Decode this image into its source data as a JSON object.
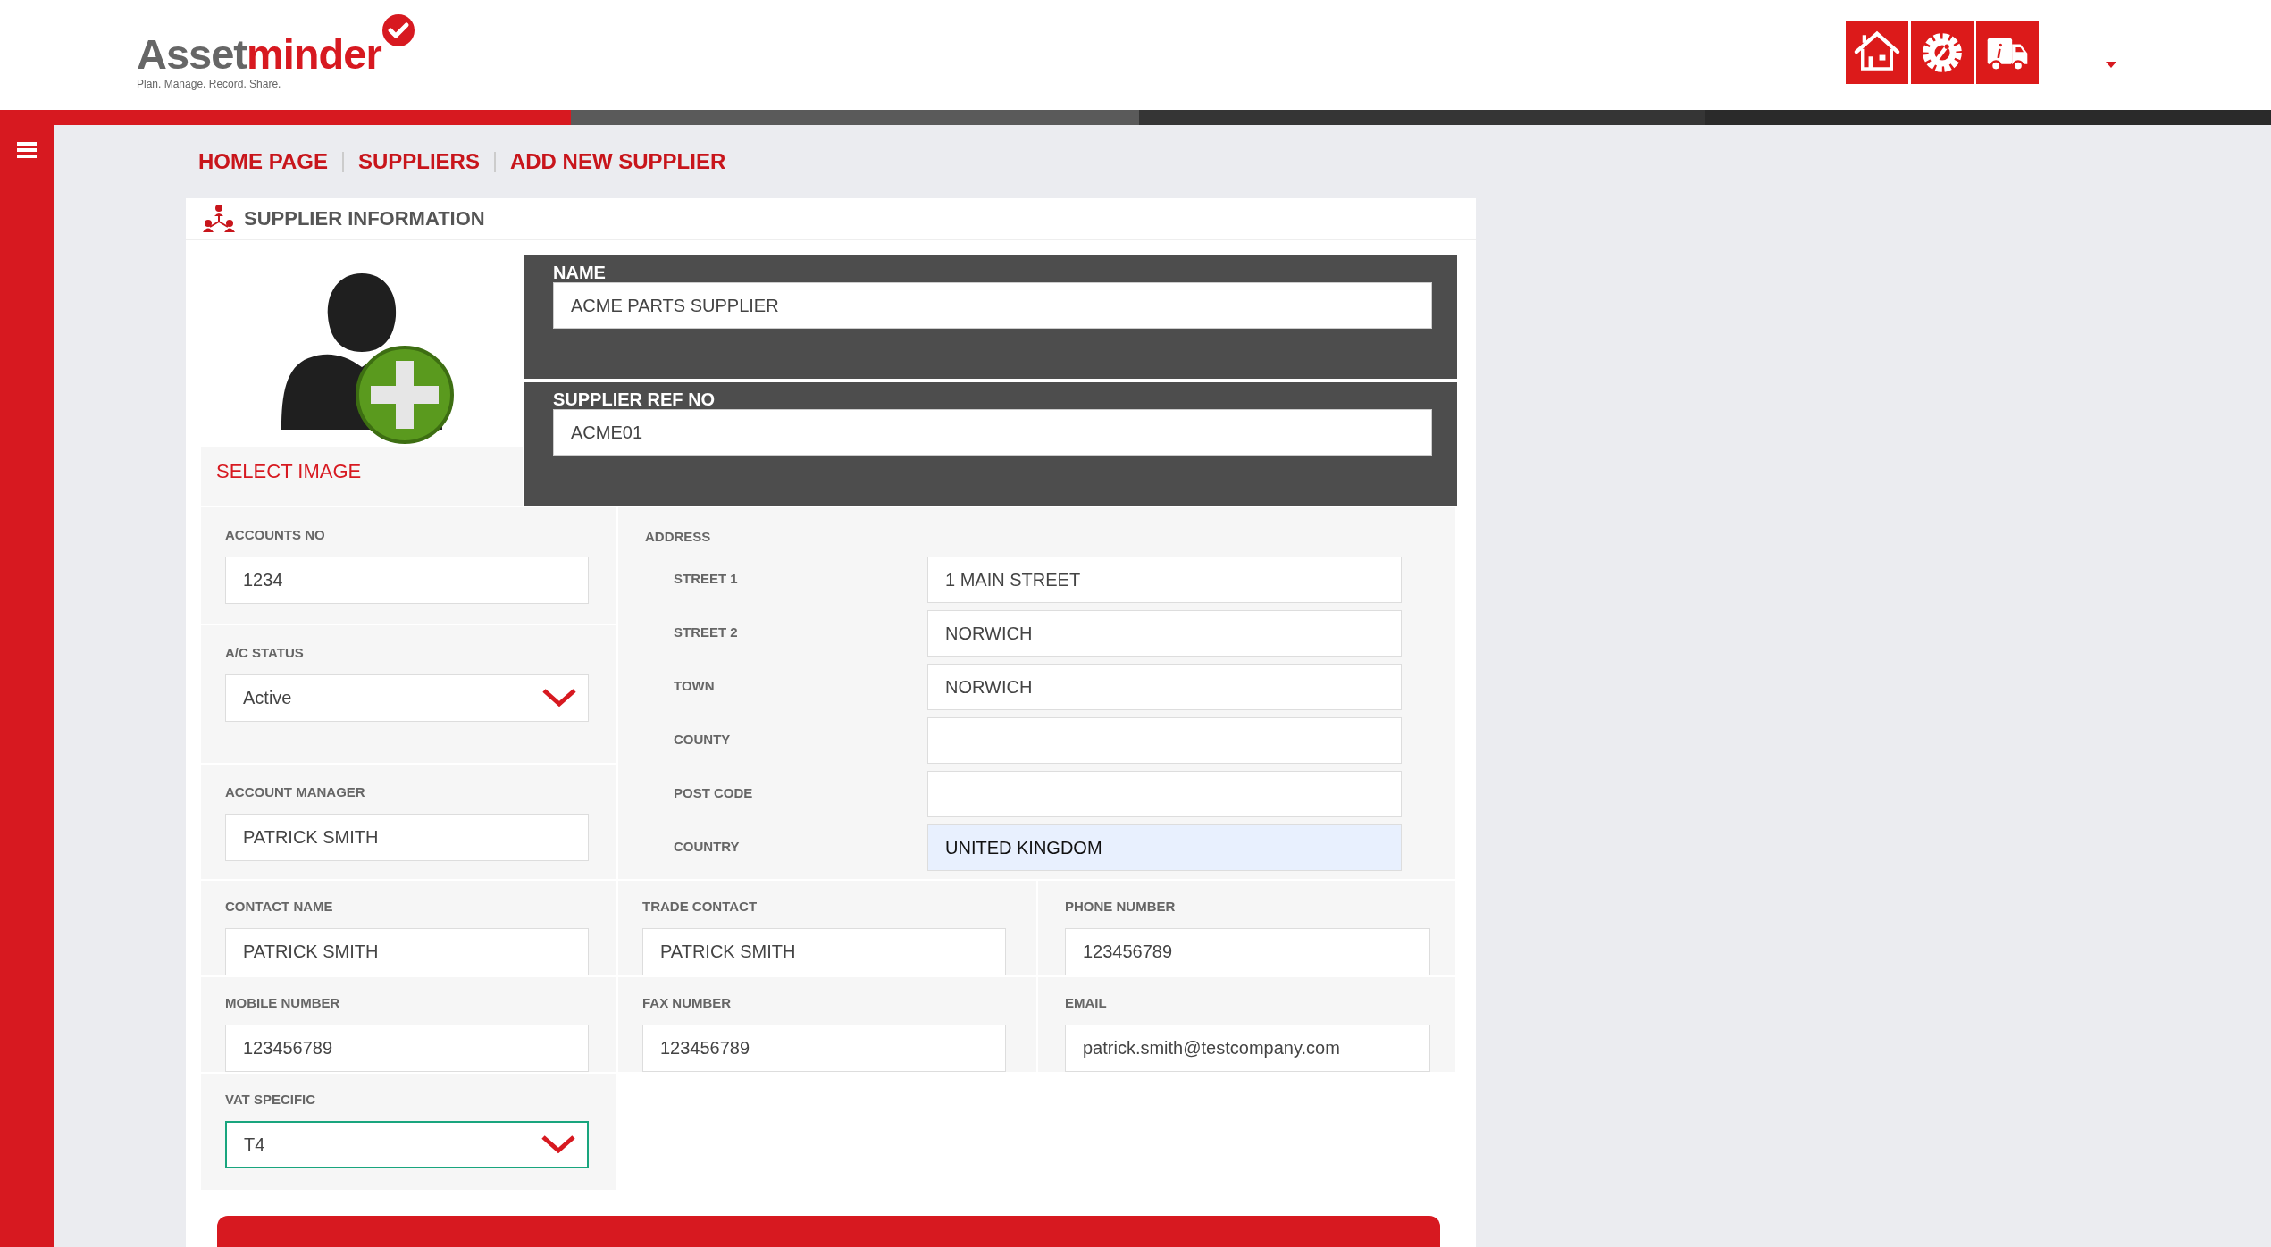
{
  "header": {
    "logo": {
      "brand_primary": "Asset",
      "brand_secondary": "minder",
      "tagline": "Plan. Manage. Record. Share."
    },
    "toolbar": [
      {
        "kind": "home"
      },
      {
        "kind": "settings"
      },
      {
        "kind": "truck-info"
      }
    ]
  },
  "breadcrumb": [
    "HOME PAGE",
    "SUPPLIERS",
    "ADD NEW SUPPLIER"
  ],
  "card": {
    "title": "SUPPLIER INFORMATION",
    "select_image": "SELECT IMAGE",
    "top_fields": [
      {
        "label": "NAME",
        "value": "ACME PARTS SUPPLIER"
      },
      {
        "label": "SUPPLIER REF NO",
        "value": "ACME01"
      }
    ],
    "left_fields": [
      {
        "label": "ACCOUNTS NO",
        "value": "1234",
        "kind": "text",
        "focused": false
      },
      {
        "label": "A/C STATUS",
        "value": "Active",
        "kind": "select",
        "focused": false
      },
      {
        "label": "ACCOUNT MANAGER",
        "value": "PATRICK SMITH",
        "kind": "text",
        "focused": false
      }
    ],
    "address": {
      "label": "ADDRESS",
      "lines": [
        {
          "label": "STREET 1",
          "value": "1 MAIN STREET",
          "highlighted": false
        },
        {
          "label": "STREET 2",
          "value": "NORWICH",
          "highlighted": false
        },
        {
          "label": "TOWN",
          "value": "NORWICH",
          "highlighted": false
        },
        {
          "label": "COUNTY",
          "highlighted": false
        },
        {
          "label": "POST CODE",
          "highlighted": false
        },
        {
          "label": "COUNTRY",
          "value": "UNITED KINGDOM",
          "highlighted": true
        }
      ]
    },
    "grid_fields": [
      {
        "label": "CONTACT NAME",
        "value": "PATRICK SMITH",
        "kind": "text",
        "focused": false
      },
      {
        "label": "TRADE CONTACT",
        "value": "PATRICK SMITH",
        "kind": "text",
        "focused": false
      },
      {
        "label": "PHONE NUMBER",
        "value": "123456789",
        "kind": "text",
        "focused": false
      },
      {
        "label": "MOBILE NUMBER",
        "value": "123456789",
        "kind": "text",
        "focused": false
      },
      {
        "label": "FAX NUMBER",
        "value": "123456789",
        "kind": "text",
        "focused": false
      },
      {
        "label": "EMAIL",
        "value": "patrick.smith@testcompany.com",
        "kind": "text",
        "focused": false
      },
      {
        "label": "VAT SPECIFIC",
        "value": "T4",
        "kind": "select",
        "focused": true
      }
    ]
  }
}
